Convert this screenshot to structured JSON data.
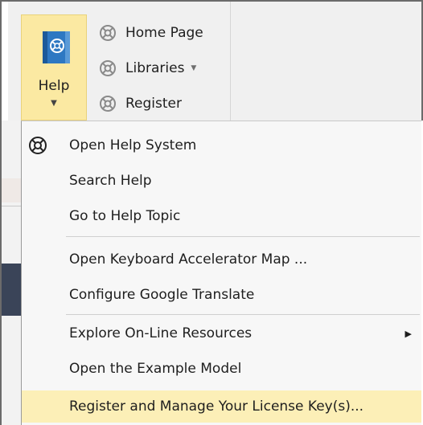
{
  "ribbon": {
    "help_label": "Help",
    "items": [
      {
        "label": "Home Page",
        "icon": "help-globe-icon"
      },
      {
        "label": "Libraries",
        "icon": "help-globe-icon",
        "has_dropdown": true
      },
      {
        "label": "Register",
        "icon": "help-globe-icon"
      }
    ]
  },
  "menu": {
    "items": [
      {
        "label": "Open Help System",
        "icon": "help-system-icon"
      },
      {
        "label": "Search Help"
      },
      {
        "label": "Go to Help Topic"
      },
      {
        "label": "Open Keyboard Accelerator Map ..."
      },
      {
        "label": "Configure Google Translate"
      },
      {
        "label": "Explore On-Line Resources",
        "has_submenu": true
      },
      {
        "label": "Open the Example Model"
      },
      {
        "label": "Register and Manage Your License Key(s)...",
        "highlighted": true
      }
    ]
  },
  "colors": {
    "highlight": "#fcefb7",
    "help_button_bg": "#fbe9a2",
    "accent_blue": "#1f6fb5"
  }
}
